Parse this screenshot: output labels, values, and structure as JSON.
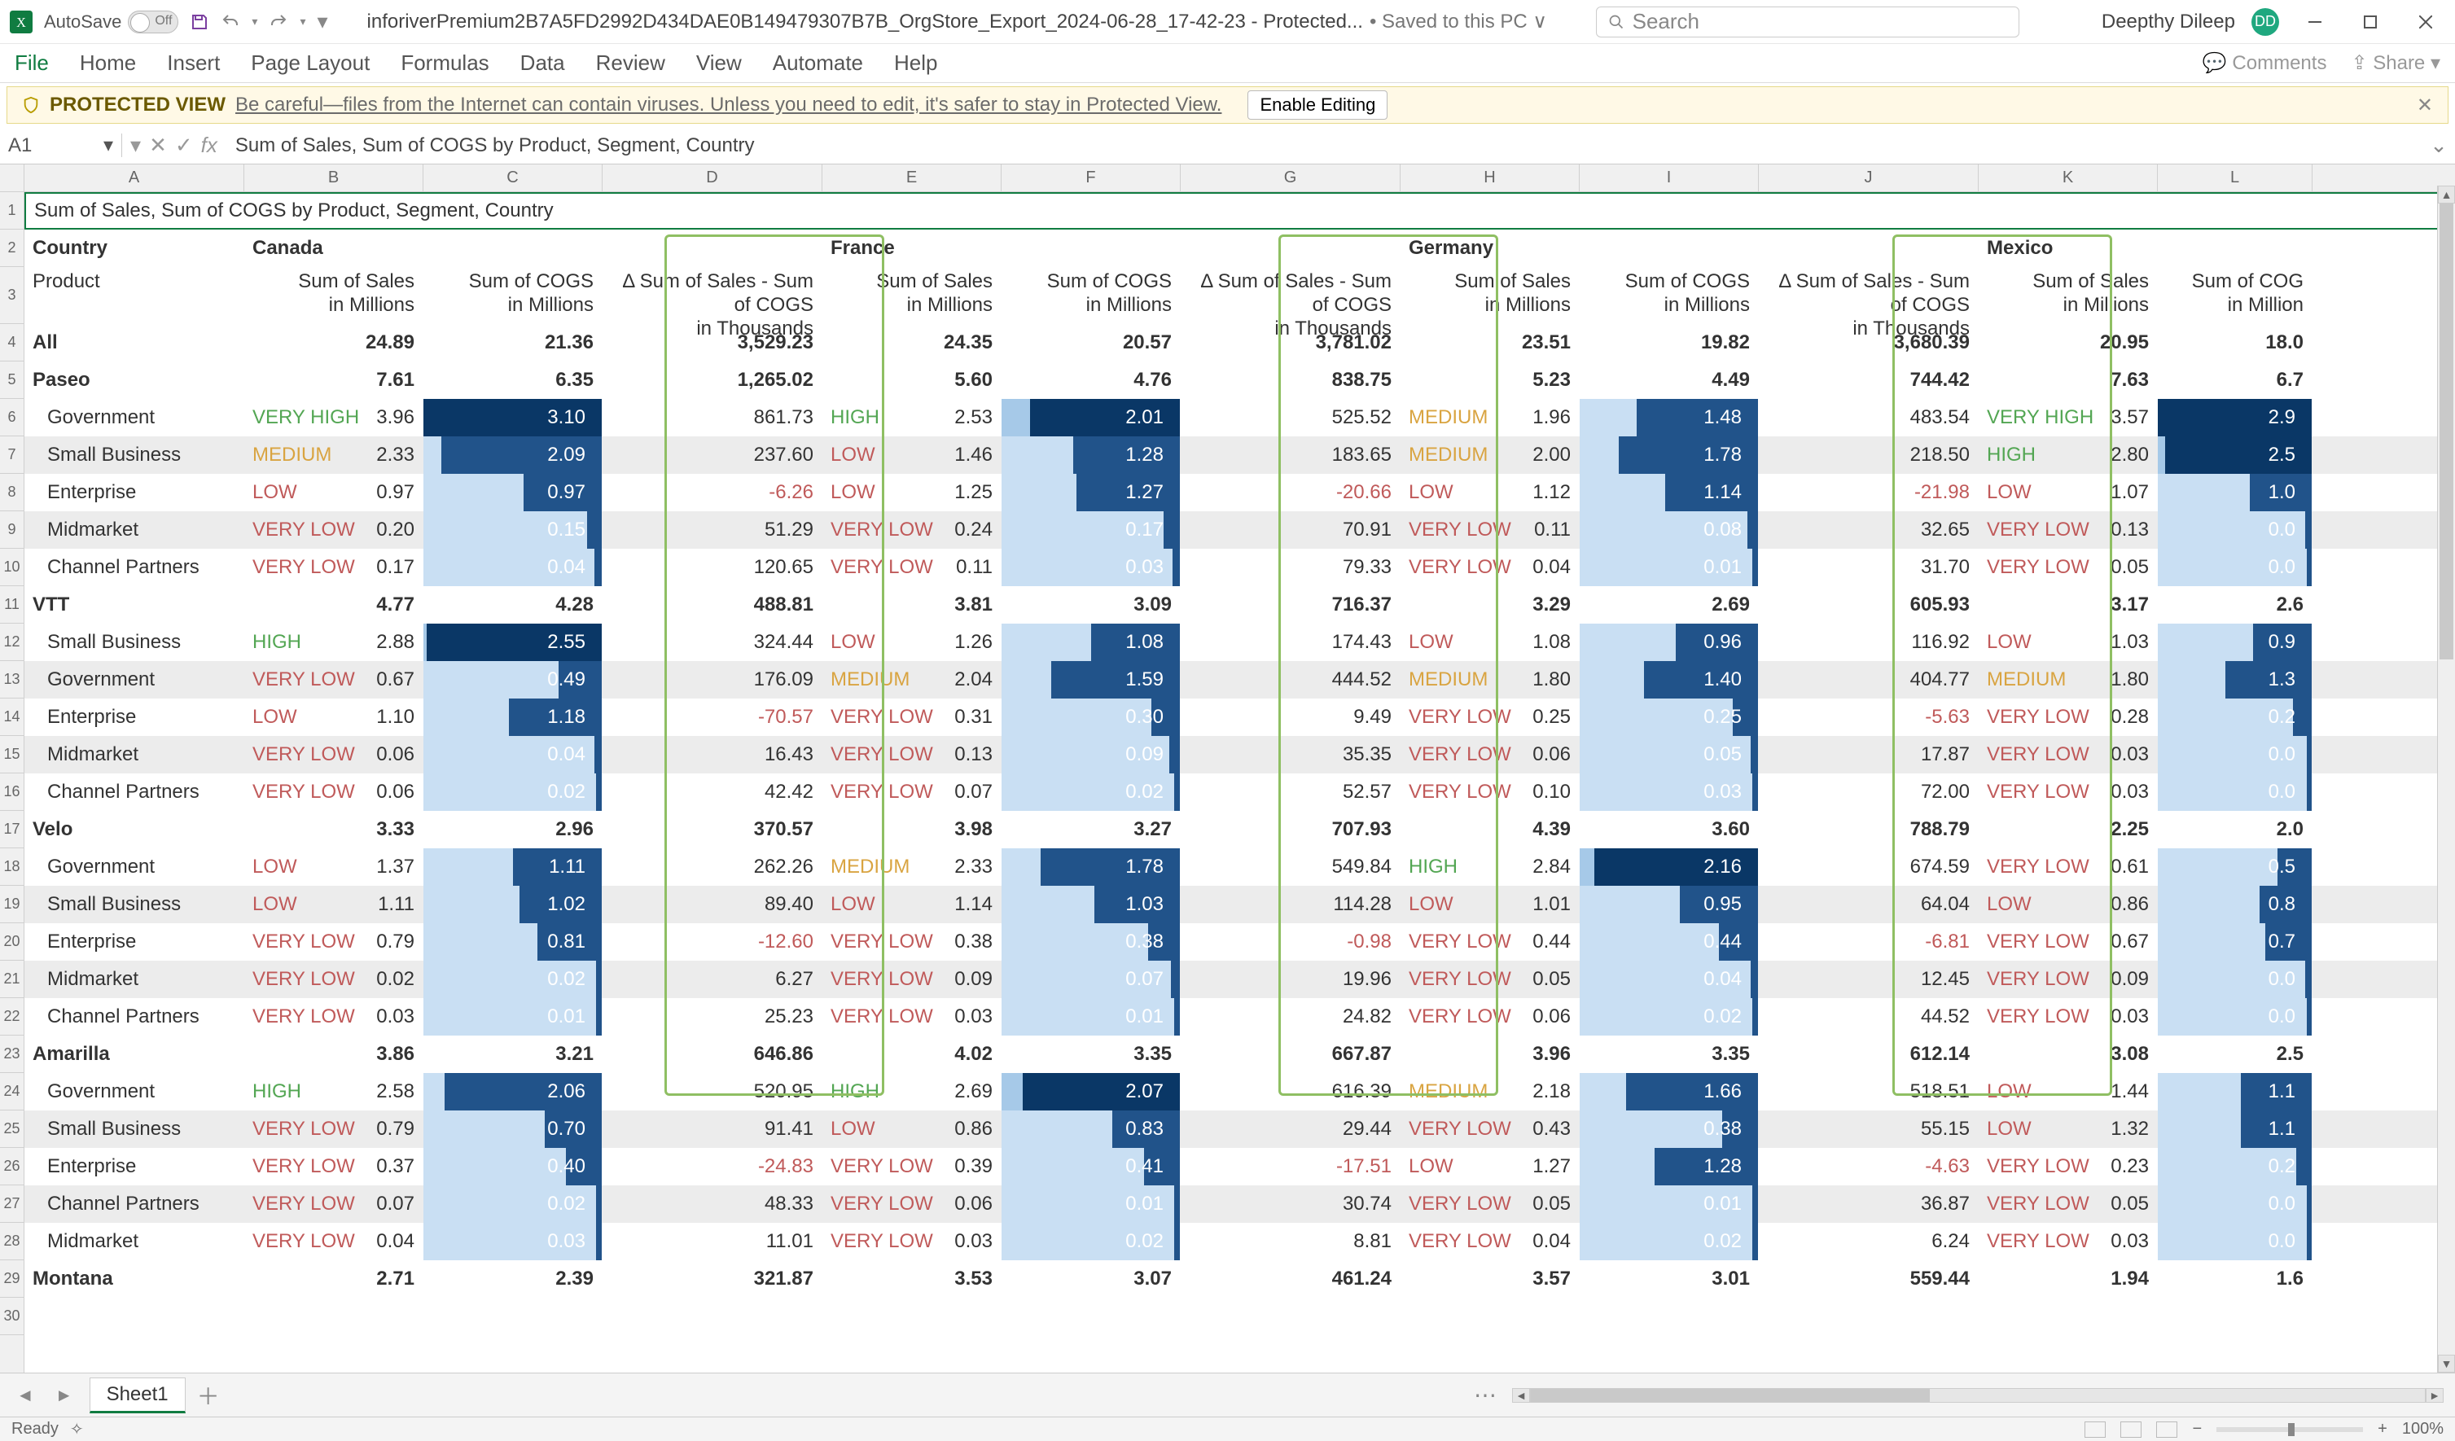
{
  "chrome": {
    "autosave_label": "AutoSave",
    "doc_name": "inforiverPremium2B7A5FD2992D434DAE0B149479307B7B_OrgStore_Export_2024-06-28_17-42-23  -  Protected...",
    "saved_suffix": " •  Saved to this PC ∨",
    "search_placeholder": "Search",
    "user_name": "Deepthy Dileep",
    "user_initials": "DD",
    "tabs": [
      "File",
      "Home",
      "Insert",
      "Page Layout",
      "Formulas",
      "Data",
      "Review",
      "View",
      "Automate",
      "Help"
    ],
    "rhs": [
      "Comments",
      "Share"
    ],
    "protected_label": "PROTECTED VIEW",
    "protected_msg": "Be careful—files from the Internet can contain viruses. Unless you need to edit, it's safer to stay in Protected View.",
    "enable_editing": "Enable Editing",
    "namebox": "A1",
    "formula": "Sum of  Sales, Sum of COGS by Product, Segment, Country",
    "sheet_name": "Sheet1",
    "status_left": "Ready",
    "zoom": "100%"
  },
  "cols": [
    "A",
    "B",
    "C",
    "D",
    "E",
    "F",
    "G",
    "H",
    "I",
    "J",
    "K",
    "L"
  ],
  "row_numbers": [
    1,
    2,
    3,
    4,
    5,
    6,
    7,
    8,
    9,
    10,
    11,
    12,
    13,
    14,
    15,
    16,
    17,
    18,
    19,
    20,
    21,
    22,
    23,
    24,
    25,
    26,
    27,
    28,
    29,
    30
  ],
  "header1": {
    "title": "Sum of  Sales, Sum of COGS by Product, Segment, Country"
  },
  "country_row": {
    "label": "Country",
    "canada": "Canada",
    "france": "France",
    "germany": "Germany",
    "mexico": "Mexico"
  },
  "metric_row": {
    "product": "Product",
    "sales": "Sum of  Sales\nin Millions",
    "cogs": "Sum of COGS\nin Millions",
    "delta": "Δ Sum of  Sales - Sum of COGS\nin Thousands",
    "cogs_trunc": "Sum of COG\nin Million"
  },
  "labels": {
    "VH": "VERY HIGH",
    "H": "HIGH",
    "M": "MEDIUM",
    "L": "LOW",
    "VL": "VERY LOW"
  },
  "rows": [
    {
      "t": "h",
      "p": "All",
      "b": "24.89",
      "c": "21.36",
      "d": "3,529.23",
      "e": "24.35",
      "f": "20.57",
      "g": "3,781.02",
      "h": "23.51",
      "i": "19.82",
      "j": "3,680.39",
      "k": "20.95",
      "l": "18.0"
    },
    {
      "t": "h",
      "p": "Paseo",
      "b": "7.61",
      "c": "6.35",
      "d": "1,265.02",
      "e": "5.60",
      "f": "4.76",
      "g": "838.75",
      "h": "5.23",
      "i": "4.49",
      "j": "744.42",
      "k": "7.63",
      "l": "6.7"
    },
    {
      "t": "d",
      "p": "Government",
      "bl": "VH",
      "b": "3.96",
      "c": "3.10",
      "cw": 100,
      "d": "861.73",
      "el": "H",
      "e": "2.53",
      "f": "2.01",
      "fw": 84,
      "g": "525.52",
      "hl": "M",
      "h": "1.96",
      "i": "1.48",
      "iw": 68,
      "j": "483.54",
      "kl": "VH",
      "k": "3.57",
      "l": "2.9",
      "lw": 100
    },
    {
      "t": "d",
      "p": "Small Business",
      "bl": "M",
      "b": "2.33",
      "c": "2.09",
      "cw": 90,
      "d": "237.60",
      "el": "L",
      "e": "1.46",
      "f": "1.28",
      "fw": 60,
      "g": "183.65",
      "hl": "M",
      "h": "2.00",
      "i": "1.78",
      "iw": 78,
      "j": "218.50",
      "kl": "H",
      "k": "2.80",
      "l": "2.5",
      "lw": 95
    },
    {
      "t": "d",
      "p": "Enterprise",
      "bl": "L",
      "b": "0.97",
      "c": "0.97",
      "cw": 44,
      "d": "-6.26",
      "el": "L",
      "e": "1.25",
      "f": "1.27",
      "fw": 58,
      "g": "-20.66",
      "hl": "L",
      "h": "1.12",
      "i": "1.14",
      "iw": 52,
      "j": "-21.98",
      "kl": "L",
      "k": "1.07",
      "l": "1.0",
      "lw": 40
    },
    {
      "t": "d",
      "p": "Midmarket",
      "bl": "VL",
      "b": "0.20",
      "c": "0.15",
      "cw": 8,
      "d": "51.29",
      "el": "VL",
      "e": "0.24",
      "f": "0.17",
      "fw": 9,
      "g": "70.91",
      "hl": "VL",
      "h": "0.11",
      "i": "0.08",
      "iw": 6,
      "j": "32.65",
      "kl": "VL",
      "k": "0.13",
      "l": "0.0",
      "lw": 4
    },
    {
      "t": "d",
      "p": "Channel Partners",
      "bl": "VL",
      "b": "0.17",
      "c": "0.04",
      "cw": 4,
      "d": "120.65",
      "el": "VL",
      "e": "0.11",
      "f": "0.03",
      "fw": 4,
      "g": "79.33",
      "hl": "VL",
      "h": "0.04",
      "i": "0.01",
      "iw": 3,
      "j": "31.70",
      "kl": "VL",
      "k": "0.05",
      "l": "0.0",
      "lw": 3
    },
    {
      "t": "h",
      "p": "VTT",
      "b": "4.77",
      "c": "4.28",
      "d": "488.81",
      "e": "3.81",
      "f": "3.09",
      "g": "716.37",
      "h": "3.29",
      "i": "2.69",
      "j": "605.93",
      "k": "3.17",
      "l": "2.6"
    },
    {
      "t": "d",
      "p": "Small Business",
      "bl": "H",
      "b": "2.88",
      "c": "2.55",
      "cw": 98,
      "d": "324.44",
      "el": "L",
      "e": "1.26",
      "f": "1.08",
      "fw": 50,
      "g": "174.43",
      "hl": "L",
      "h": "1.08",
      "i": "0.96",
      "iw": 46,
      "j": "116.92",
      "kl": "L",
      "k": "1.03",
      "l": "0.9",
      "lw": 38
    },
    {
      "t": "d",
      "p": "Government",
      "bl": "VL",
      "b": "0.67",
      "c": "0.49",
      "cw": 24,
      "d": "176.09",
      "el": "M",
      "e": "2.04",
      "f": "1.59",
      "fw": 72,
      "g": "444.52",
      "hl": "M",
      "h": "1.80",
      "i": "1.40",
      "iw": 64,
      "j": "404.77",
      "kl": "M",
      "k": "1.80",
      "l": "1.3",
      "lw": 56
    },
    {
      "t": "d",
      "p": "Enterprise",
      "bl": "L",
      "b": "1.10",
      "c": "1.18",
      "cw": 52,
      "d": "-70.57",
      "el": "VL",
      "e": "0.31",
      "f": "0.30",
      "fw": 16,
      "g": "9.49",
      "hl": "VL",
      "h": "0.25",
      "i": "0.25",
      "iw": 14,
      "j": "-5.63",
      "kl": "VL",
      "k": "0.28",
      "l": "0.2",
      "lw": 12
    },
    {
      "t": "d",
      "p": "Midmarket",
      "bl": "VL",
      "b": "0.06",
      "c": "0.04",
      "cw": 4,
      "d": "16.43",
      "el": "VL",
      "e": "0.13",
      "f": "0.09",
      "fw": 6,
      "g": "35.35",
      "hl": "VL",
      "h": "0.06",
      "i": "0.05",
      "iw": 4,
      "j": "17.87",
      "kl": "VL",
      "k": "0.03",
      "l": "0.0",
      "lw": 3
    },
    {
      "t": "d",
      "p": "Channel Partners",
      "bl": "VL",
      "b": "0.06",
      "c": "0.02",
      "cw": 3,
      "d": "42.42",
      "el": "VL",
      "e": "0.07",
      "f": "0.02",
      "fw": 3,
      "g": "52.57",
      "hl": "VL",
      "h": "0.10",
      "i": "0.03",
      "iw": 3,
      "j": "72.00",
      "kl": "VL",
      "k": "0.03",
      "l": "0.0",
      "lw": 3
    },
    {
      "t": "h",
      "p": "Velo",
      "b": "3.33",
      "c": "2.96",
      "d": "370.57",
      "e": "3.98",
      "f": "3.27",
      "g": "707.93",
      "h": "4.39",
      "i": "3.60",
      "j": "788.79",
      "k": "2.25",
      "l": "2.0"
    },
    {
      "t": "d",
      "p": "Government",
      "bl": "L",
      "b": "1.37",
      "c": "1.11",
      "cw": 50,
      "d": "262.26",
      "el": "M",
      "e": "2.33",
      "f": "1.78",
      "fw": 78,
      "g": "549.84",
      "hl": "H",
      "h": "2.84",
      "i": "2.16",
      "iw": 92,
      "j": "674.59",
      "kl": "VL",
      "k": "0.61",
      "l": "0.5",
      "lw": 22
    },
    {
      "t": "d",
      "p": "Small Business",
      "bl": "L",
      "b": "1.11",
      "c": "1.02",
      "cw": 46,
      "d": "89.40",
      "el": "L",
      "e": "1.14",
      "f": "1.03",
      "fw": 48,
      "g": "114.28",
      "hl": "L",
      "h": "1.01",
      "i": "0.95",
      "iw": 44,
      "j": "64.04",
      "kl": "L",
      "k": "0.86",
      "l": "0.8",
      "lw": 34
    },
    {
      "t": "d",
      "p": "Enterprise",
      "bl": "VL",
      "b": "0.79",
      "c": "0.81",
      "cw": 36,
      "d": "-12.60",
      "el": "VL",
      "e": "0.38",
      "f": "0.38",
      "fw": 18,
      "g": "-0.98",
      "hl": "VL",
      "h": "0.44",
      "i": "0.44",
      "iw": 22,
      "j": "-6.81",
      "kl": "VL",
      "k": "0.67",
      "l": "0.7",
      "lw": 30
    },
    {
      "t": "d",
      "p": "Midmarket",
      "bl": "VL",
      "b": "0.02",
      "c": "0.02",
      "cw": 3,
      "d": "6.27",
      "el": "VL",
      "e": "0.09",
      "f": "0.07",
      "fw": 5,
      "g": "19.96",
      "hl": "VL",
      "h": "0.05",
      "i": "0.04",
      "iw": 4,
      "j": "12.45",
      "kl": "VL",
      "k": "0.09",
      "l": "0.0",
      "lw": 4
    },
    {
      "t": "d",
      "p": "Channel Partners",
      "bl": "VL",
      "b": "0.03",
      "c": "0.01",
      "cw": 3,
      "d": "25.23",
      "el": "VL",
      "e": "0.03",
      "f": "0.01",
      "fw": 3,
      "g": "24.82",
      "hl": "VL",
      "h": "0.06",
      "i": "0.02",
      "iw": 3,
      "j": "44.52",
      "kl": "VL",
      "k": "0.03",
      "l": "0.0",
      "lw": 3
    },
    {
      "t": "h",
      "p": "Amarilla",
      "b": "3.86",
      "c": "3.21",
      "d": "646.86",
      "e": "4.02",
      "f": "3.35",
      "g": "667.87",
      "h": "3.96",
      "i": "3.35",
      "j": "612.14",
      "k": "3.08",
      "l": "2.5"
    },
    {
      "t": "d",
      "p": "Government",
      "bl": "H",
      "b": "2.58",
      "c": "2.06",
      "cw": 88,
      "d": "520.95",
      "el": "H",
      "e": "2.69",
      "f": "2.07",
      "fw": 88,
      "g": "616.39",
      "hl": "M",
      "h": "2.18",
      "i": "1.66",
      "iw": 74,
      "j": "518.51",
      "kl": "L",
      "k": "1.44",
      "l": "1.1",
      "lw": 46
    },
    {
      "t": "d",
      "p": "Small Business",
      "bl": "VL",
      "b": "0.79",
      "c": "0.70",
      "cw": 32,
      "d": "91.41",
      "el": "L",
      "e": "0.86",
      "f": "0.83",
      "fw": 38,
      "g": "29.44",
      "hl": "VL",
      "h": "0.43",
      "i": "0.38",
      "iw": 20,
      "j": "55.15",
      "kl": "L",
      "k": "1.32",
      "l": "1.1",
      "lw": 46
    },
    {
      "t": "d",
      "p": "Enterprise",
      "bl": "VL",
      "b": "0.37",
      "c": "0.40",
      "cw": 20,
      "d": "-24.83",
      "el": "VL",
      "e": "0.39",
      "f": "0.41",
      "fw": 20,
      "g": "-17.51",
      "hl": "L",
      "h": "1.27",
      "i": "1.28",
      "iw": 58,
      "j": "-4.63",
      "kl": "VL",
      "k": "0.23",
      "l": "0.2",
      "lw": 10
    },
    {
      "t": "d",
      "p": "Channel Partners",
      "bl": "VL",
      "b": "0.07",
      "c": "0.02",
      "cw": 3,
      "d": "48.33",
      "el": "VL",
      "e": "0.06",
      "f": "0.01",
      "fw": 3,
      "g": "30.74",
      "hl": "VL",
      "h": "0.05",
      "i": "0.01",
      "iw": 3,
      "j": "36.87",
      "kl": "VL",
      "k": "0.05",
      "l": "0.0",
      "lw": 3
    },
    {
      "t": "d",
      "p": "Midmarket",
      "bl": "VL",
      "b": "0.04",
      "c": "0.03",
      "cw": 3,
      "d": "11.01",
      "el": "VL",
      "e": "0.03",
      "f": "0.02",
      "fw": 3,
      "g": "8.81",
      "hl": "VL",
      "h": "0.04",
      "i": "0.02",
      "iw": 3,
      "j": "6.24",
      "kl": "VL",
      "k": "0.03",
      "l": "0.0",
      "lw": 3
    },
    {
      "t": "h",
      "p": "Montana",
      "b": "2.71",
      "c": "2.39",
      "d": "321.87",
      "e": "3.53",
      "f": "3.07",
      "g": "461.24",
      "h": "3.57",
      "i": "3.01",
      "j": "559.44",
      "k": "1.94",
      "l": "1.6"
    }
  ]
}
